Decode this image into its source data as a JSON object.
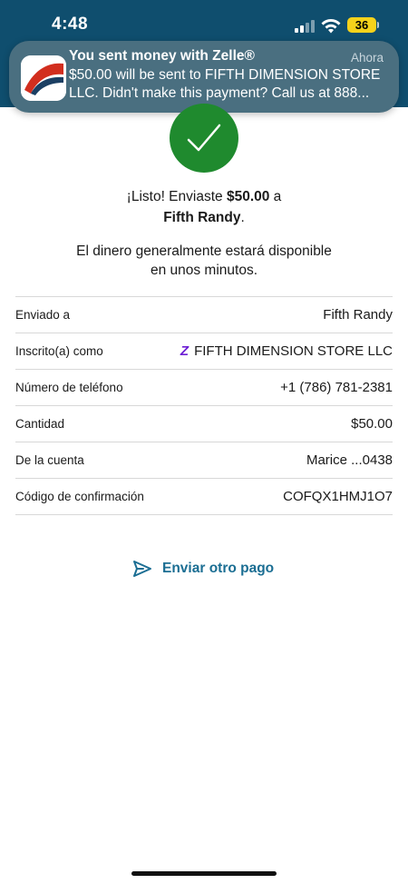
{
  "status_bar": {
    "time": "4:48",
    "battery": "36"
  },
  "notification": {
    "title": "You sent money with Zelle®",
    "time": "Ahora",
    "body_line1": "$50.00 will be sent to FIFTH DIMENSION STORE",
    "body_line2": "LLC. Didn't make this payment? Call us at 888..."
  },
  "confirmation": {
    "prefix": "¡Listo! Enviaste ",
    "amount": "$50.00",
    "suffix": " a",
    "recipient": "Fifth Randy",
    "end": ".",
    "info_line1": "El dinero generalmente estará disponible",
    "info_line2": "en unos minutos."
  },
  "details": [
    {
      "label": "Enviado a",
      "value": "Fifth Randy"
    },
    {
      "label": "Inscrito(a) como",
      "value": "FIFTH DIMENSION STORE LLC"
    },
    {
      "label": "Número de teléfono",
      "value": "+1 (786) 781-2381"
    },
    {
      "label": "Cantidad",
      "value": "$50.00"
    },
    {
      "label": "De la cuenta",
      "value": "Marice ...0438"
    },
    {
      "label": "Código de confirmación",
      "value": "COFQX1HMJ1O7"
    }
  ],
  "actions": {
    "send_again": "Enviar otro pago"
  },
  "colors": {
    "header": "#0f4e6e",
    "success": "#1f8a2e",
    "link": "#1b6e93",
    "zelle": "#6d1ed4"
  }
}
